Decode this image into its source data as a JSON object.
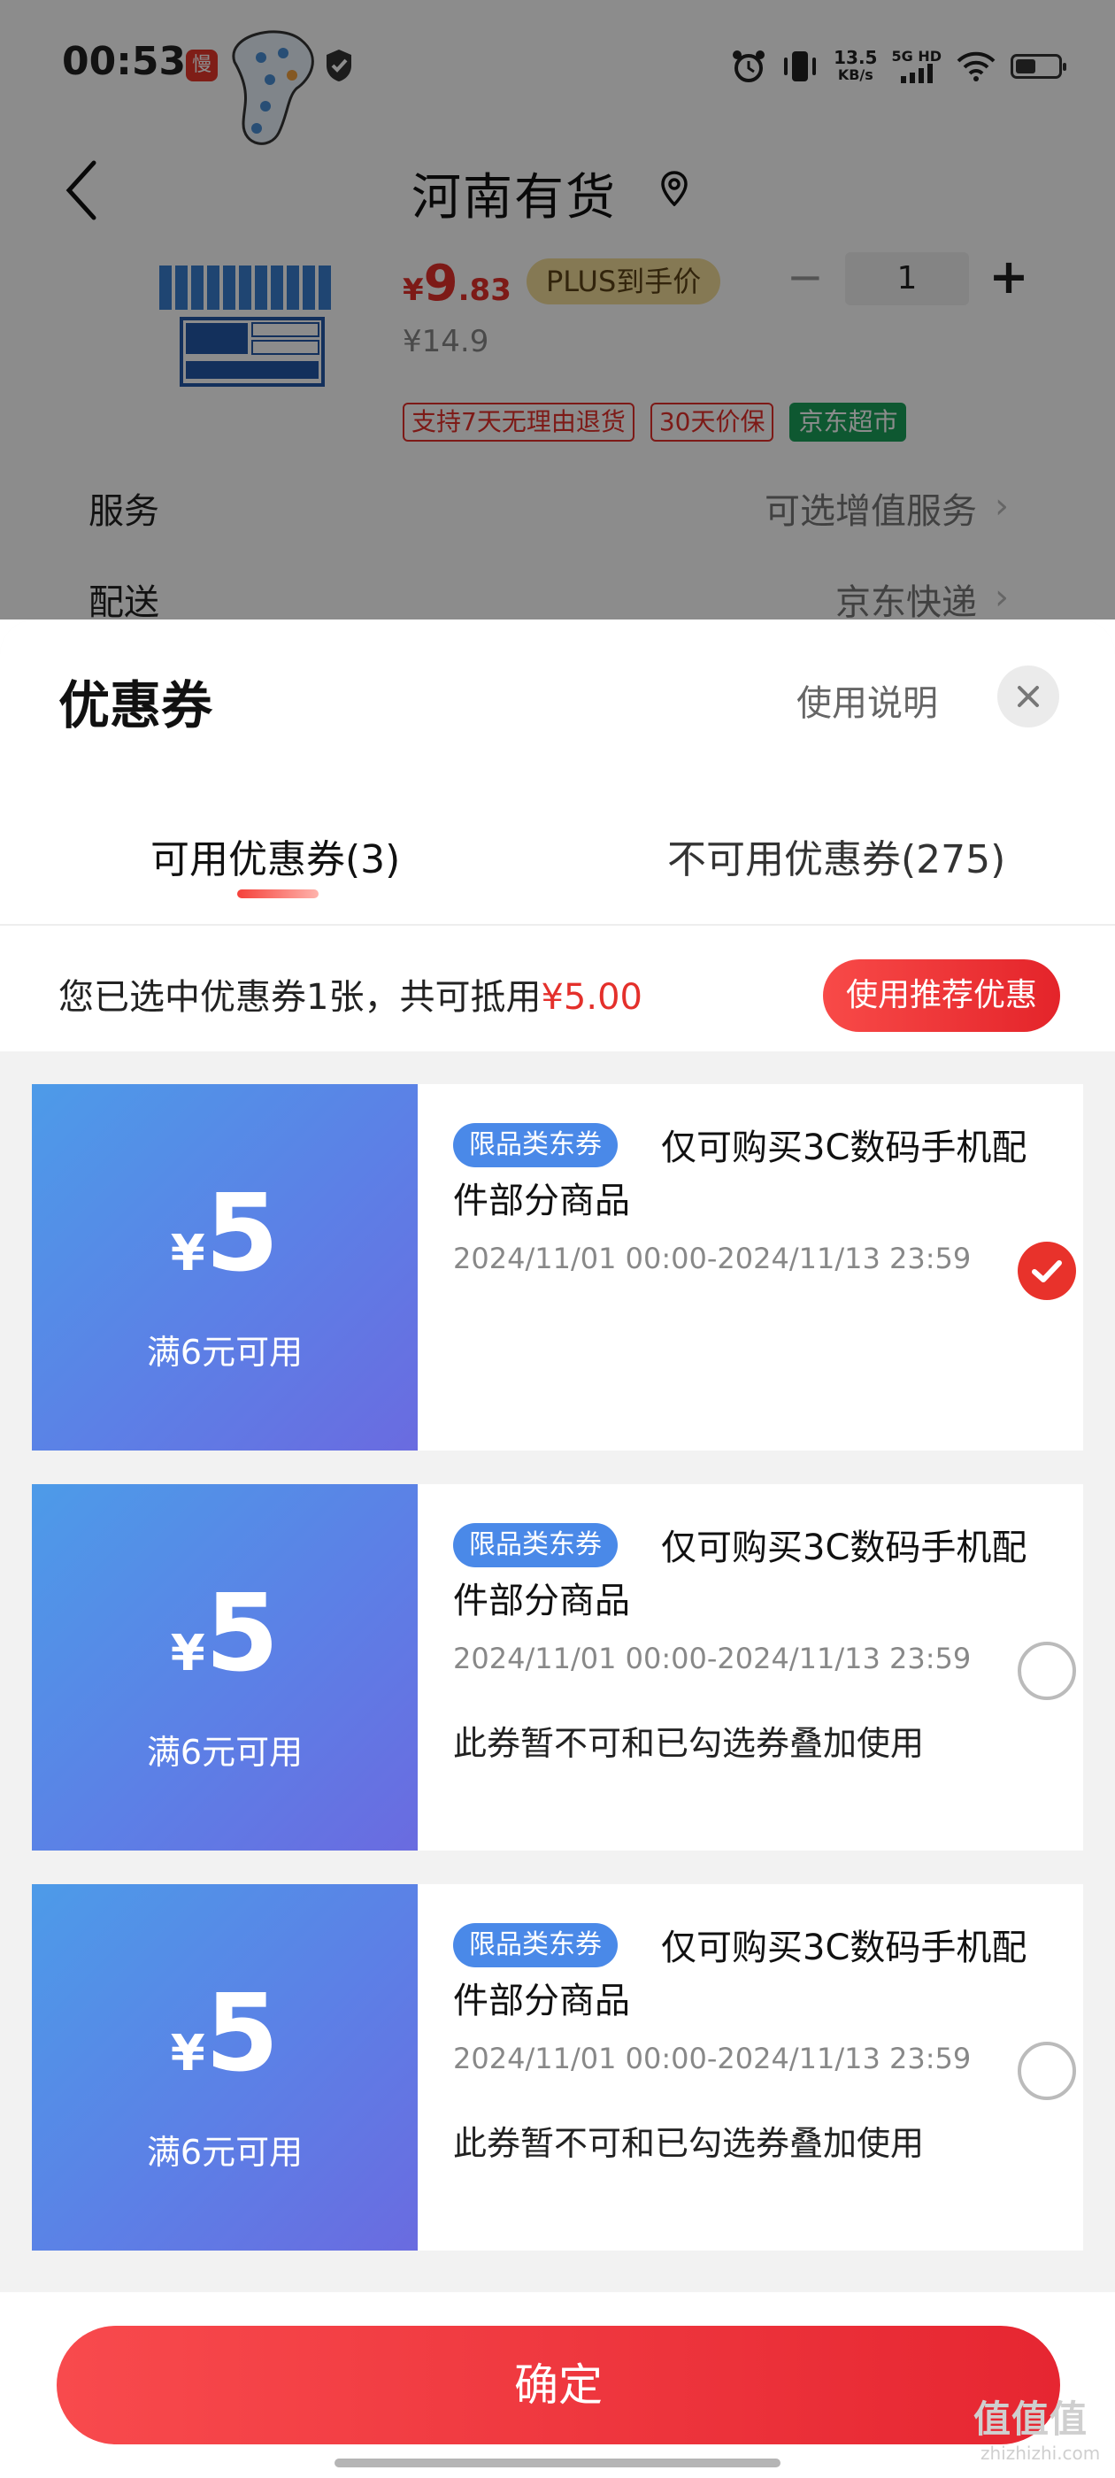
{
  "status_bar": {
    "time": "00:53",
    "app_icon_text": "慢",
    "net_speed_value": "13.5",
    "net_speed_unit": "KB/s",
    "network_label": "5G HD",
    "battery_level_percent": 35
  },
  "nav": {
    "title": "河南有货"
  },
  "product": {
    "price_symbol": "¥",
    "price_int": "9",
    "price_dec": ".83",
    "plus_badge": "PLUS到手价",
    "original_price": "¥14.9",
    "quantity": "1",
    "tags": [
      "支持7天无理由退货",
      "30天价保",
      "京东超市"
    ]
  },
  "info_rows": [
    {
      "label": "服务",
      "value": "可选增值服务"
    },
    {
      "label": "配送",
      "value": "京东快递"
    }
  ],
  "sheet": {
    "title": "优惠券",
    "usage_link": "使用说明",
    "tabs": [
      {
        "label": "可用优惠券(3)",
        "active": true
      },
      {
        "label": "不可用优惠券(275)",
        "active": false
      }
    ],
    "summary_prefix": "您已选中优惠券1张，共可抵用",
    "summary_amount": "¥5.00",
    "recommend_button": "使用推荐优惠"
  },
  "coupons": [
    {
      "currency": "¥",
      "amount": "5",
      "condition": "满6元可用",
      "badge": "限品类东券",
      "description": "仅可购买3C数码手机配件部分商品",
      "validity": "2024/11/01 00:00-2024/11/13 23:59",
      "note": "",
      "selected": true
    },
    {
      "currency": "¥",
      "amount": "5",
      "condition": "满6元可用",
      "badge": "限品类东券",
      "description": "仅可购买3C数码手机配件部分商品",
      "validity": "2024/11/01 00:00-2024/11/13 23:59",
      "note": "此券暂不可和已勾选券叠加使用",
      "selected": false
    },
    {
      "currency": "¥",
      "amount": "5",
      "condition": "满6元可用",
      "badge": "限品类东券",
      "description": "仅可购买3C数码手机配件部分商品",
      "validity": "2024/11/01 00:00-2024/11/13 23:59",
      "note": "此券暂不可和已勾选券叠加使用",
      "selected": false
    }
  ],
  "footer": {
    "confirm_button": "确定"
  },
  "watermark": {
    "text": "值值值",
    "sub": "zhizhizhi.com"
  },
  "colors": {
    "accent_red": "#e4302b",
    "coupon_blue": "#5c80e6",
    "badge_blue": "#4a89e8",
    "jd_green": "#1aa05a"
  }
}
